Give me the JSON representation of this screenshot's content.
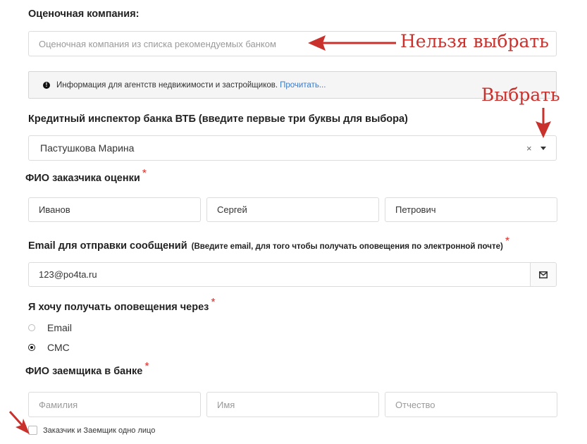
{
  "appraisal": {
    "label": "Оценочная компания:",
    "placeholder": "Оценочная компания из списка рекомендуемых банком"
  },
  "info_banner": {
    "text": "Информация для агентств недвижимости и застройщиков.",
    "link": "Прочитать..."
  },
  "inspector": {
    "label": "Кредитный инспектор банка ВТБ (введите первые три буквы для выбора)",
    "value": "Пастушкова Марина",
    "clear": "×"
  },
  "customer": {
    "label": "ФИО заказчика оценки",
    "required": "*",
    "last_name": "Иванов",
    "first_name": "Сергей",
    "middle_name": "Петрович"
  },
  "email": {
    "label": "Email для отправки сообщений",
    "hint": "(Введите email, для того чтобы получать оповещения по электронной почте)",
    "required": "*",
    "value": "123@po4ta.ru"
  },
  "notify": {
    "label": "Я хочу получать оповещения через",
    "required": "*",
    "options": [
      "Email",
      "СМС"
    ],
    "selected": "СМС"
  },
  "borrower": {
    "label": "ФИО заемщика в банке",
    "required": "*",
    "last_placeholder": "Фамилия",
    "first_placeholder": "Имя",
    "middle_placeholder": "Отчество"
  },
  "same_person": {
    "label": "Заказчик и Заемщик одно лицо",
    "checked": false
  },
  "annotations": {
    "cannot_select": "Нельзя выбрать",
    "select": "Выбрать",
    "color": "#c9312d"
  }
}
